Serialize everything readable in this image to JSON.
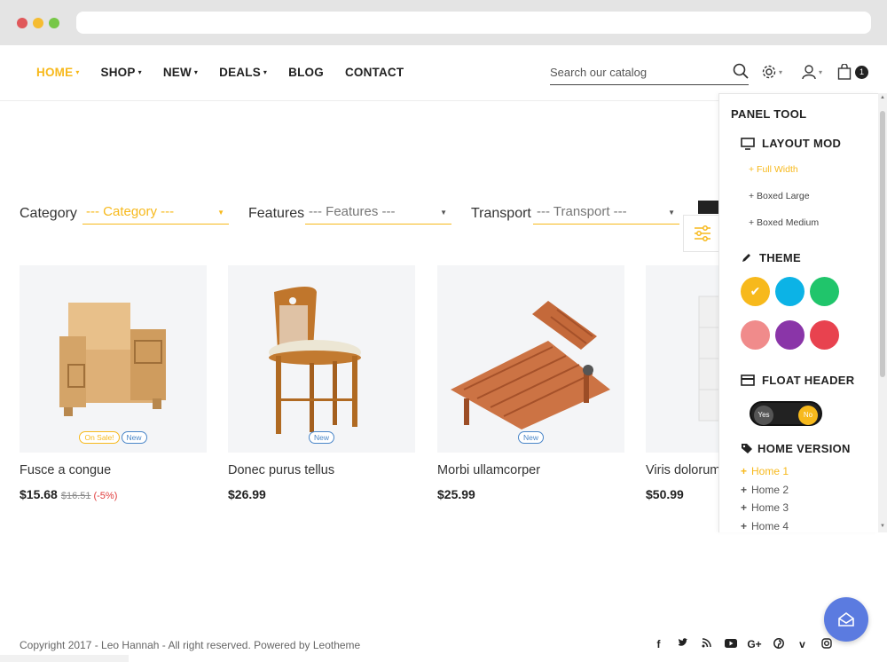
{
  "browser": {
    "dots": [
      "#e0585a",
      "#f5bc31",
      "#77c747"
    ]
  },
  "nav": {
    "items": [
      {
        "label": "HOME",
        "caret": "⌄",
        "active": true
      },
      {
        "label": "SHOP",
        "caret": "⌄"
      },
      {
        "label": "NEW",
        "caret": "⌄"
      },
      {
        "label": "DEALS",
        "caret": "⌄"
      },
      {
        "label": "BLOG"
      },
      {
        "label": "CONTACT"
      }
    ]
  },
  "search": {
    "placeholder": "Search our catalog",
    "icon": "search-icon"
  },
  "cart": {
    "count": "1"
  },
  "filters": {
    "category_label": "Category",
    "category_value": "--- Category ---",
    "features_label": "Features",
    "features_value": "--- Features ---",
    "transport_label": "Transport",
    "transport_value": "--- Transport ---"
  },
  "products": [
    {
      "name": "Fusce a congue",
      "price": "$15.68",
      "old_price": "$16.51",
      "discount": "(-5%)",
      "badge_sale": "On Sale!",
      "badge_new": "New"
    },
    {
      "name": "Donec purus tellus",
      "price": "$26.99",
      "badge_new": "New"
    },
    {
      "name": "Morbi ullamcorper",
      "price": "$25.99",
      "badge_new": "New"
    },
    {
      "name": "Viris dolorum s",
      "price": "$50.99"
    }
  ],
  "panel": {
    "title": "PANEL TOOL",
    "layout_title": "LAYOUT MOD",
    "layout_options": [
      "+ Full Width",
      "+ Boxed Large",
      "+ Boxed Medium"
    ],
    "theme_title": "THEME",
    "theme_colors": [
      "#f7b91c",
      "#0cb3e6",
      "#20c56b",
      "#f08b8b",
      "#8a35a8",
      "#e8424f"
    ],
    "float_header_title": "FLOAT HEADER",
    "toggle_yes": "Yes",
    "toggle_no": "No",
    "home_version_title": "HOME VERSION",
    "home_versions": [
      "Home 1",
      "Home 2",
      "Home 3",
      "Home 4"
    ]
  },
  "footer": {
    "copyright": "Copyright 2017 - Leo Hannah - All right reserved. Powered by Leotheme",
    "social": [
      "f",
      "t",
      "rss",
      "yt",
      "G+",
      "p",
      "v",
      "ig"
    ]
  },
  "colors": {
    "accent": "#f7b91c",
    "fab": "#5b7be0"
  }
}
